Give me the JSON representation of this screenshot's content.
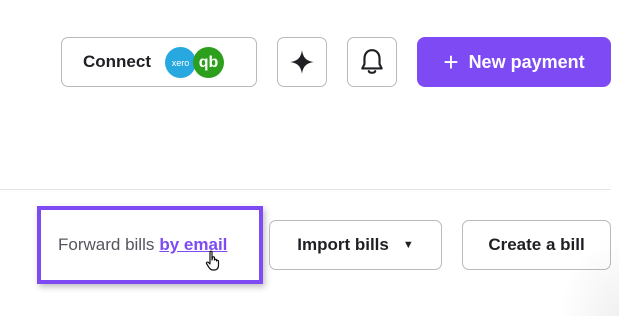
{
  "header": {
    "connect_label": "Connect",
    "xero_logo": "xero",
    "qb_logo": "qb",
    "assistant_icon": "sparkle-icon",
    "notifications_icon": "bell-icon",
    "new_payment_label": "New payment",
    "new_payment_icon": "+"
  },
  "toolbar": {
    "forward_text": "Forward bills",
    "forward_link": "by email",
    "import_label": "Import bills",
    "import_caret": "▼",
    "create_label": "Create a bill"
  },
  "colors": {
    "accent": "#7d4af4",
    "xero": "#27a9e0",
    "quickbooks": "#2ca01c"
  }
}
